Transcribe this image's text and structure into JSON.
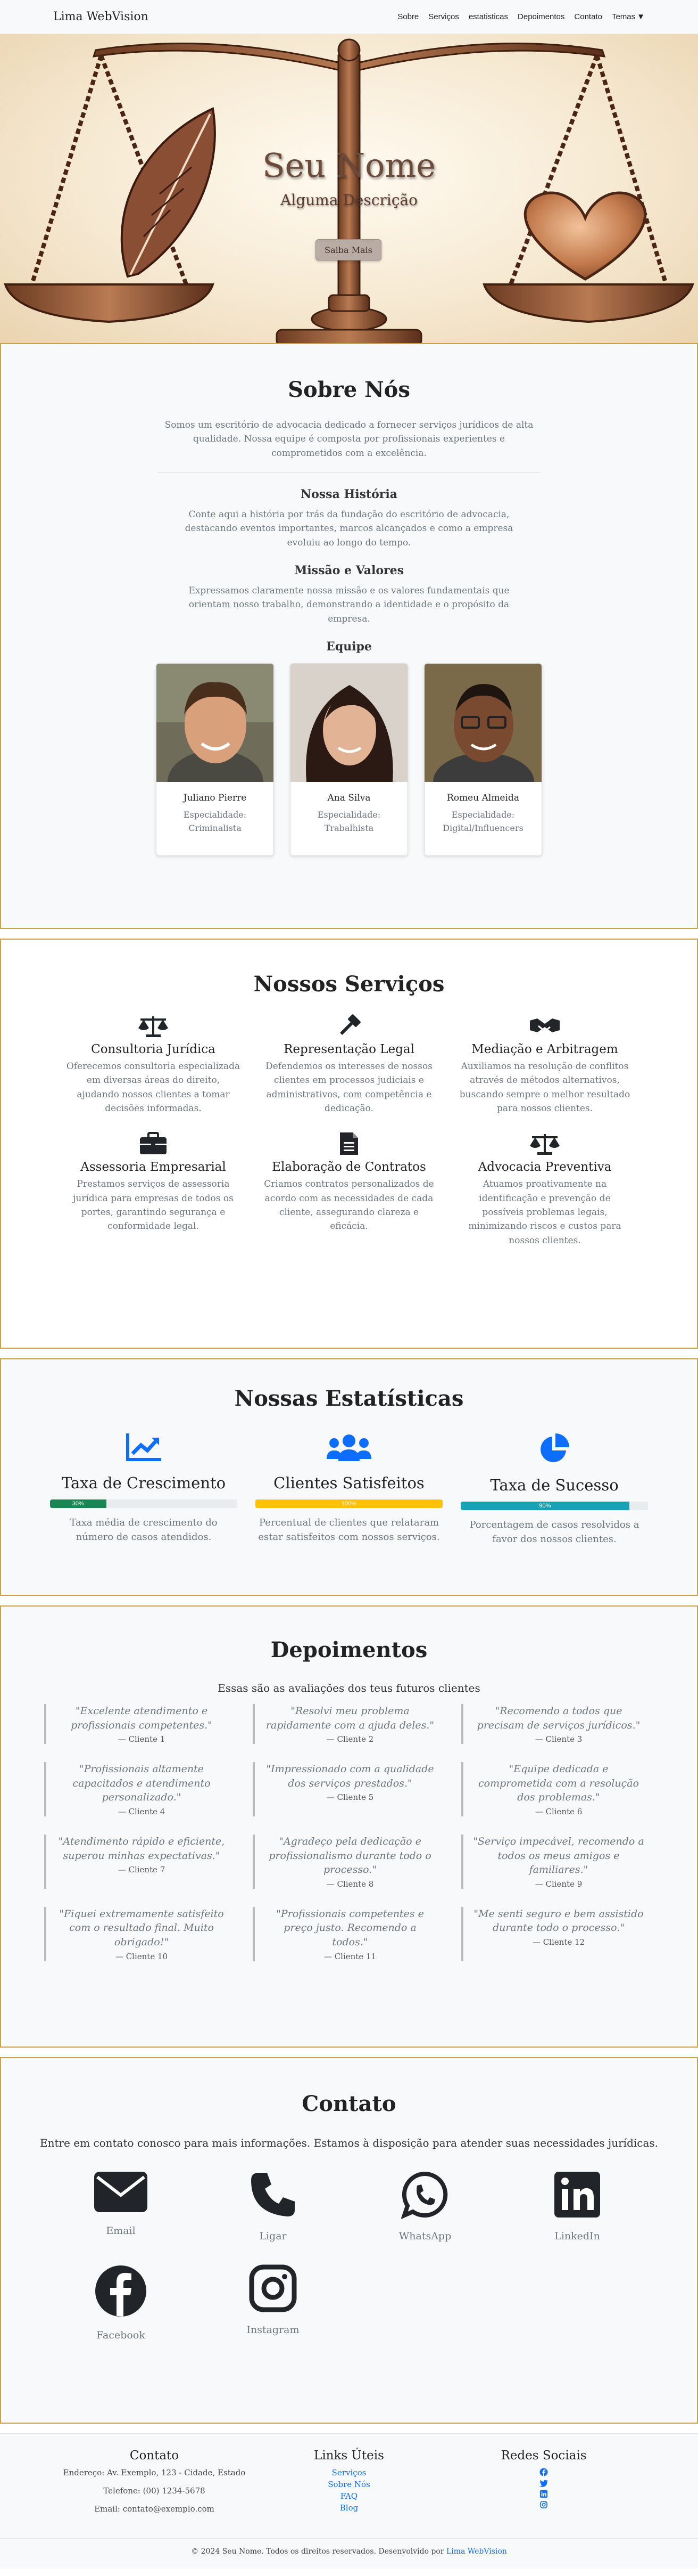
{
  "nav": {
    "brand": "Lima WebVision",
    "links": [
      "Sobre",
      "Serviços",
      "estatisticas",
      "Depoimentos",
      "Contato"
    ],
    "dropdown": "Temas"
  },
  "hero": {
    "title": "Seu Nome",
    "subtitle": "Alguma Descrição",
    "button": "Saiba Mais"
  },
  "about": {
    "title": "Sobre Nós",
    "intro": "Somos um escritório de advocacia dedicado a fornecer serviços jurídicos de alta qualidade. Nossa equipe é composta por profissionais experientes e comprometidos com a excelência.",
    "history_title": "Nossa História",
    "history_text": "Conte aqui a história por trás da fundação do escritório de advocacia, destacando eventos importantes, marcos alcançados e como a empresa evoluiu ao longo do tempo.",
    "mission_title": "Missão e Valores",
    "mission_text": "Expressamos claramente nossa missão e os valores fundamentais que orientam nosso trabalho, demonstrando a identidade e o propósito da empresa.",
    "team_title": "Equipe",
    "team": [
      {
        "name": "Juliano Pierre",
        "spec_label": "Especialidade:",
        "spec": "Criminalista"
      },
      {
        "name": "Ana Silva",
        "spec_label": "Especialidade:",
        "spec": "Trabalhista"
      },
      {
        "name": "Romeu Almeida",
        "spec_label": "Especialidade:",
        "spec": "Digital/Influencers"
      }
    ]
  },
  "services": {
    "title": "Nossos Serviços",
    "items": [
      {
        "icon": "scale-icon",
        "title": "Consultoria Jurídica",
        "text": "Oferecemos consultoria especializada em diversas áreas do direito, ajudando nossos clientes a tomar decisões informadas."
      },
      {
        "icon": "gavel-icon",
        "title": "Representação Legal",
        "text": "Defendemos os interesses de nossos clientes em processos judiciais e administrativos, com competência e dedicação."
      },
      {
        "icon": "handshake-icon",
        "title": "Mediação e Arbitragem",
        "text": "Auxiliamos na resolução de conflitos através de métodos alternativos, buscando sempre o melhor resultado para nossos clientes."
      },
      {
        "icon": "briefcase-icon",
        "title": "Assessoria Empresarial",
        "text": "Prestamos serviços de assessoria jurídica para empresas de todos os portes, garantindo segurança e conformidade legal."
      },
      {
        "icon": "document-icon",
        "title": "Elaboração de Contratos",
        "text": "Criamos contratos personalizados de acordo com as necessidades de cada cliente, assegurando clareza e eficácia."
      },
      {
        "icon": "scale-icon",
        "title": "Advocacia Preventiva",
        "text": "Atuamos proativamente na identificação e prevenção de possíveis problemas legais, minimizando riscos e custos para nossos clientes."
      }
    ]
  },
  "stats": {
    "title": "Nossas Estatísticas",
    "items": [
      {
        "icon": "chart-line-icon",
        "title": "Taxa de Crescimento",
        "value": 30,
        "label": "30%",
        "color": "#198754",
        "text": "Taxa média de crescimento do número de casos atendidos."
      },
      {
        "icon": "users-icon",
        "title": "Clientes Satisfeitos",
        "value": 100,
        "label": "100%",
        "color": "#ffc107",
        "text": "Percentual de clientes que relataram estar satisfeitos com nossos serviços."
      },
      {
        "icon": "pie-chart-icon",
        "title": "Taxa de Sucesso",
        "value": 90,
        "label": "90%",
        "color": "#17a2b8",
        "text": "Porcentagem de casos resolvidos a favor dos nossos clientes."
      }
    ]
  },
  "testimonials": {
    "title": "Depoimentos",
    "intro": "Essas são as avaliações dos teus futuros clientes",
    "items": [
      {
        "quote": "\"Excelente atendimento e profissionais competentes.\"",
        "author": "— Cliente 1"
      },
      {
        "quote": "\"Resolvi meu problema rapidamente com a ajuda deles.\"",
        "author": "— Cliente 2"
      },
      {
        "quote": "\"Recomendo a todos que precisam de serviços jurídicos.\"",
        "author": "— Cliente 3"
      },
      {
        "quote": "\"Profissionais altamente capacitados e atendimento personalizado.\"",
        "author": "— Cliente 4"
      },
      {
        "quote": "\"Impressionado com a qualidade dos serviços prestados.\"",
        "author": "— Cliente 5"
      },
      {
        "quote": "\"Equipe dedicada e comprometida com a resolução dos problemas.\"",
        "author": "— Cliente 6"
      },
      {
        "quote": "\"Atendimento rápido e eficiente, superou minhas expectativas.\"",
        "author": "— Cliente 7"
      },
      {
        "quote": "\"Agradeço pela dedicação e profissionalismo durante todo o processo.\"",
        "author": "— Cliente 8"
      },
      {
        "quote": "\"Serviço impecável, recomendo a todos os meus amigos e familiares.\"",
        "author": "— Cliente 9"
      },
      {
        "quote": "\"Fiquei extremamente satisfeito com o resultado final. Muito obrigado!\"",
        "author": "— Cliente 10"
      },
      {
        "quote": "\"Profissionais competentes e preço justo. Recomendo a todos.\"",
        "author": "— Cliente 11"
      },
      {
        "quote": "\"Me senti seguro e bem assistido durante todo o processo.\"",
        "author": "— Cliente 12"
      }
    ]
  },
  "contact": {
    "title": "Contato",
    "intro": "Entre em contato conosco para mais informações. Estamos à disposição para atender suas necessidades jurídicas.",
    "items": [
      {
        "icon": "envelope-icon",
        "label": "Email"
      },
      {
        "icon": "phone-icon",
        "label": "Ligar"
      },
      {
        "icon": "whatsapp-icon",
        "label": "WhatsApp"
      },
      {
        "icon": "linkedin-icon",
        "label": "LinkedIn"
      },
      {
        "icon": "facebook-icon",
        "label": "Facebook"
      },
      {
        "icon": "instagram-icon",
        "label": "Instagram"
      }
    ]
  },
  "footer": {
    "contact_title": "Contato",
    "address": "Endereço: Av. Exemplo, 123 - Cidade, Estado",
    "phone": "Telefone: (00) 1234-5678",
    "email": "Email: contato@exemplo.com",
    "links_title": "Links Úteis",
    "links": [
      "Serviços",
      "Sobre Nós",
      "FAQ",
      "Blog"
    ],
    "social_title": "Redes Sociais",
    "social": [
      "facebook-icon",
      "twitter-icon",
      "linkedin-icon",
      "instagram-icon"
    ],
    "copyright": "© 2024 Seu Nome. Todos os direitos reservados. Desenvolvido por",
    "developer": "Lima WebVision"
  },
  "colors": {
    "section_border": "#c9a14a",
    "link": "#0d6efd",
    "icon_blue": "#0d6efd",
    "icon_dark": "#212529"
  }
}
